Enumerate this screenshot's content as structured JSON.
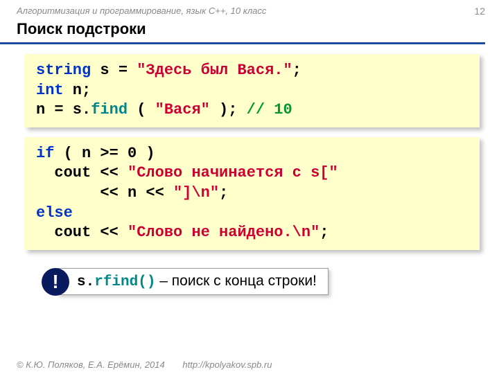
{
  "header": "Алгоритмизация и программирование, язык С++, 10 класс",
  "pageNumber": "12",
  "title": "Поиск подстроки",
  "code1": {
    "l1_kw": "string",
    "l1_rest": " s = ",
    "l1_str": "\"Здесь был Вася.\"",
    "l1_semi": ";",
    "l2_kw": "int",
    "l2_rest": " n;",
    "l3_pre": "n = s.",
    "l3_find": "find",
    "l3_paren": " ( ",
    "l3_str": "\"Вася\"",
    "l3_close": " );  ",
    "l3_comment": "// 10"
  },
  "code2": {
    "l1_if": "if",
    "l1_cond": " ( n >= 0 )",
    "l2_pre": "  cout << ",
    "l2_str": "\"Слово начинается с s[\"",
    "l3_pre": "       << n << ",
    "l3_str": "\"]\\n\"",
    "l3_semi": ";",
    "l4_else": "else",
    "l5_pre": "  cout << ",
    "l5_str": "\"Слово не найдено.\\n\"",
    "l5_semi": ";"
  },
  "note": {
    "excl": "!",
    "pre": "s.",
    "fn": "rfind()",
    "rest": " – поиск с конца строки!"
  },
  "footer": {
    "copy": "© К.Ю. Поляков, Е.А. Ерёмин, 2014",
    "url": "http://kpolyakov.spb.ru"
  }
}
